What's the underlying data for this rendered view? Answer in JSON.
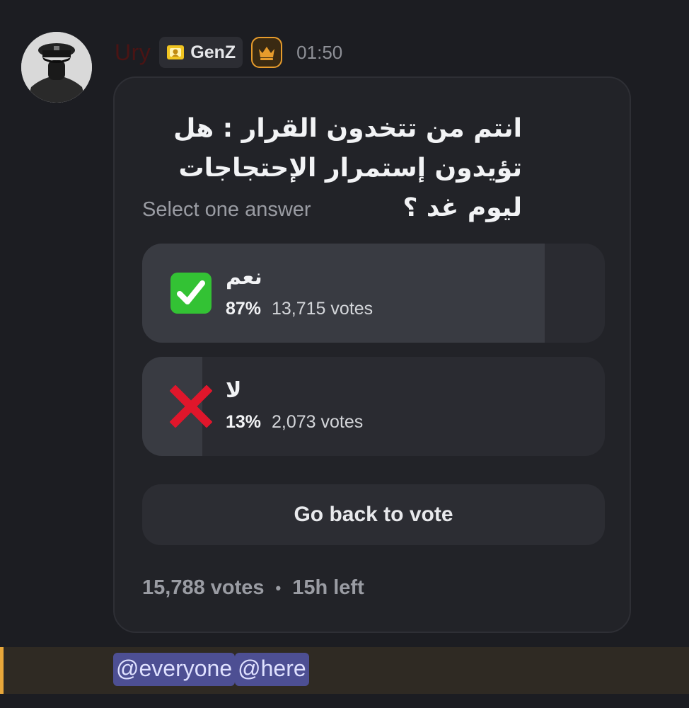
{
  "message": {
    "username": "Ury",
    "tag": "GenZ",
    "timestamp": "01:50",
    "icons": {
      "avatar": "avatar-photo",
      "tag": "tag-badge-icon",
      "crown": "crown-icon"
    }
  },
  "poll": {
    "question": "انتم من تتخدون القرار : هل تؤيدون إستمرار الإحتجاجات ليوم غد ؟",
    "subtitle": "Select one answer",
    "options": [
      {
        "label": "نعم",
        "percent": "87%",
        "votes": "13,715 votes",
        "fill": 0.87,
        "icon": "check-mark-icon",
        "icon_color": "#33c234"
      },
      {
        "label": "لا",
        "percent": "13%",
        "votes": "2,073 votes",
        "fill": 0.13,
        "icon": "cross-mark-icon",
        "icon_color": "#e0162b"
      }
    ],
    "back_button": "Go back to vote",
    "total_votes": "15,788 votes",
    "separator": "•",
    "time_left": "15h left"
  },
  "mentions": [
    "@everyone",
    "@here"
  ],
  "colors": {
    "background": "#1c1d22",
    "card": "#222328",
    "mention_bg": "#4d4f93",
    "highlight_bar": "#e8a73a",
    "crown": "#e79c2c"
  }
}
